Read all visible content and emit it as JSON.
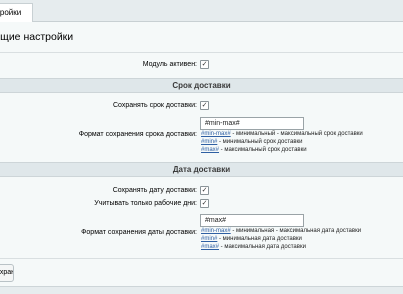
{
  "tabs": [
    {
      "label": "Настройки"
    }
  ],
  "page": {
    "title": "Общие настройки"
  },
  "general": {
    "module_active_label": "Модуль активен:"
  },
  "delivery_period": {
    "section_title": "Срок доставки",
    "save_label": "Сохранять срок доставки:",
    "format_label": "Формат сохранения срока доставки:",
    "format_value": "#min-max#",
    "hints": [
      {
        "code": "#min-max#",
        "text": " - минимальный - максимальный срок доставки"
      },
      {
        "code": "#min#",
        "text": " - минимальный срок доставки"
      },
      {
        "code": "#max#",
        "text": " - максимальный срок доставки"
      }
    ]
  },
  "delivery_date": {
    "section_title": "Дата доставки",
    "save_label": "Сохранять дату доставки:",
    "workdays_label": "Учитывать только рабочие дни:",
    "format_label": "Формат сохранения даты доставки:",
    "format_value": "#max#",
    "hints": [
      {
        "code": "#min-max#",
        "text": " - минимальная - максимальная дата доставки"
      },
      {
        "code": "#min#",
        "text": " - минимальная дата доставки"
      },
      {
        "code": "#max#",
        "text": " - максимальная дата доставки"
      }
    ]
  },
  "footer": {
    "save_button": "Сохранить"
  },
  "icons": {
    "checkbox_checked": "checkmark-icon"
  }
}
